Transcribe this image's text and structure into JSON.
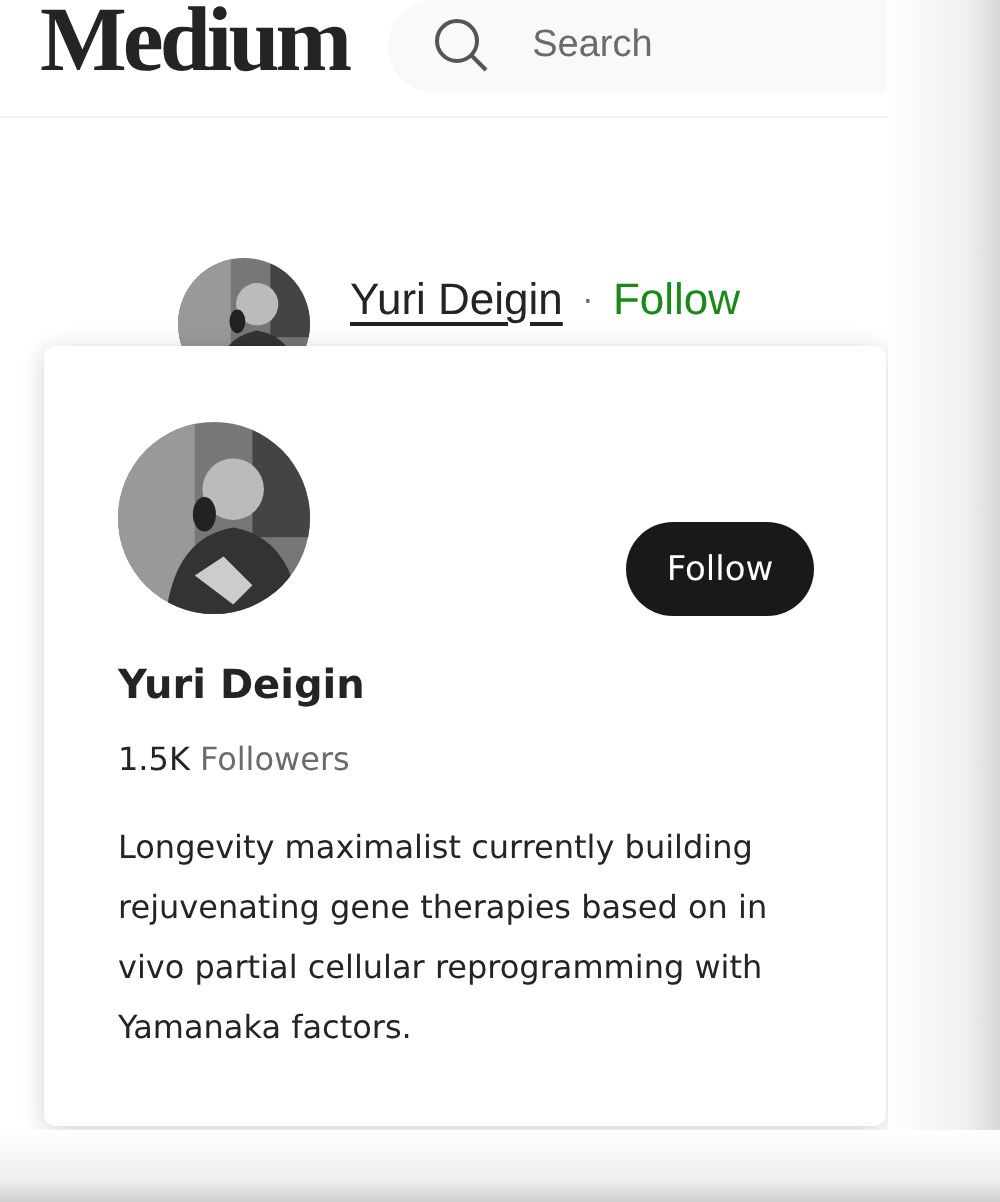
{
  "header": {
    "logo": "Medium",
    "search": {
      "placeholder": "Search"
    }
  },
  "author": {
    "name": "Yuri Deigin",
    "separator": "·",
    "follow": "Follow"
  },
  "popover": {
    "name": "Yuri Deigin",
    "follow_button": "Follow",
    "followers_count": "1.5K",
    "followers_label": "Followers",
    "bio": "Longevity maximalist currently building rejuvenating gene therapies based on in vivo partial cellular reprogramming with Yamanaka factors."
  }
}
